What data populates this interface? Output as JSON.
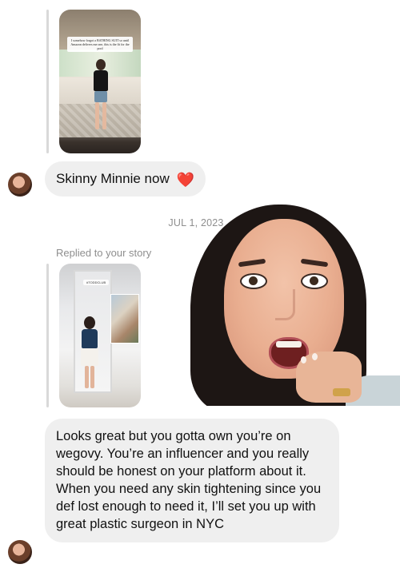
{
  "thread": {
    "messages": [
      {
        "type": "story_reply",
        "story": {
          "caption": "I somehow forgot a BATHING SUIT so until Amazon delivers me one, this is the fit for the pool"
        },
        "text": "Skinny Minnie now",
        "emoji": "heart-on-fire"
      },
      {
        "type": "date_divider",
        "text": "JUL 1, 2023"
      },
      {
        "type": "story_reply",
        "replied_label": "Replied to your story",
        "story": {
          "tag": "#TODDCLUB"
        },
        "text": "Looks great but you gotta own you’re on wegovy. You’re an influencer and you really should be honest on your platform about it. When you need any skin tightening since you def lost enough to need it, I’ll set you up with great plastic surgeon in NYC"
      }
    ]
  },
  "colors": {
    "bubble_bg": "#efefef",
    "meta_text": "#8e8e8e",
    "reply_line": "#d9d9d9",
    "heart": "#e0312b"
  }
}
